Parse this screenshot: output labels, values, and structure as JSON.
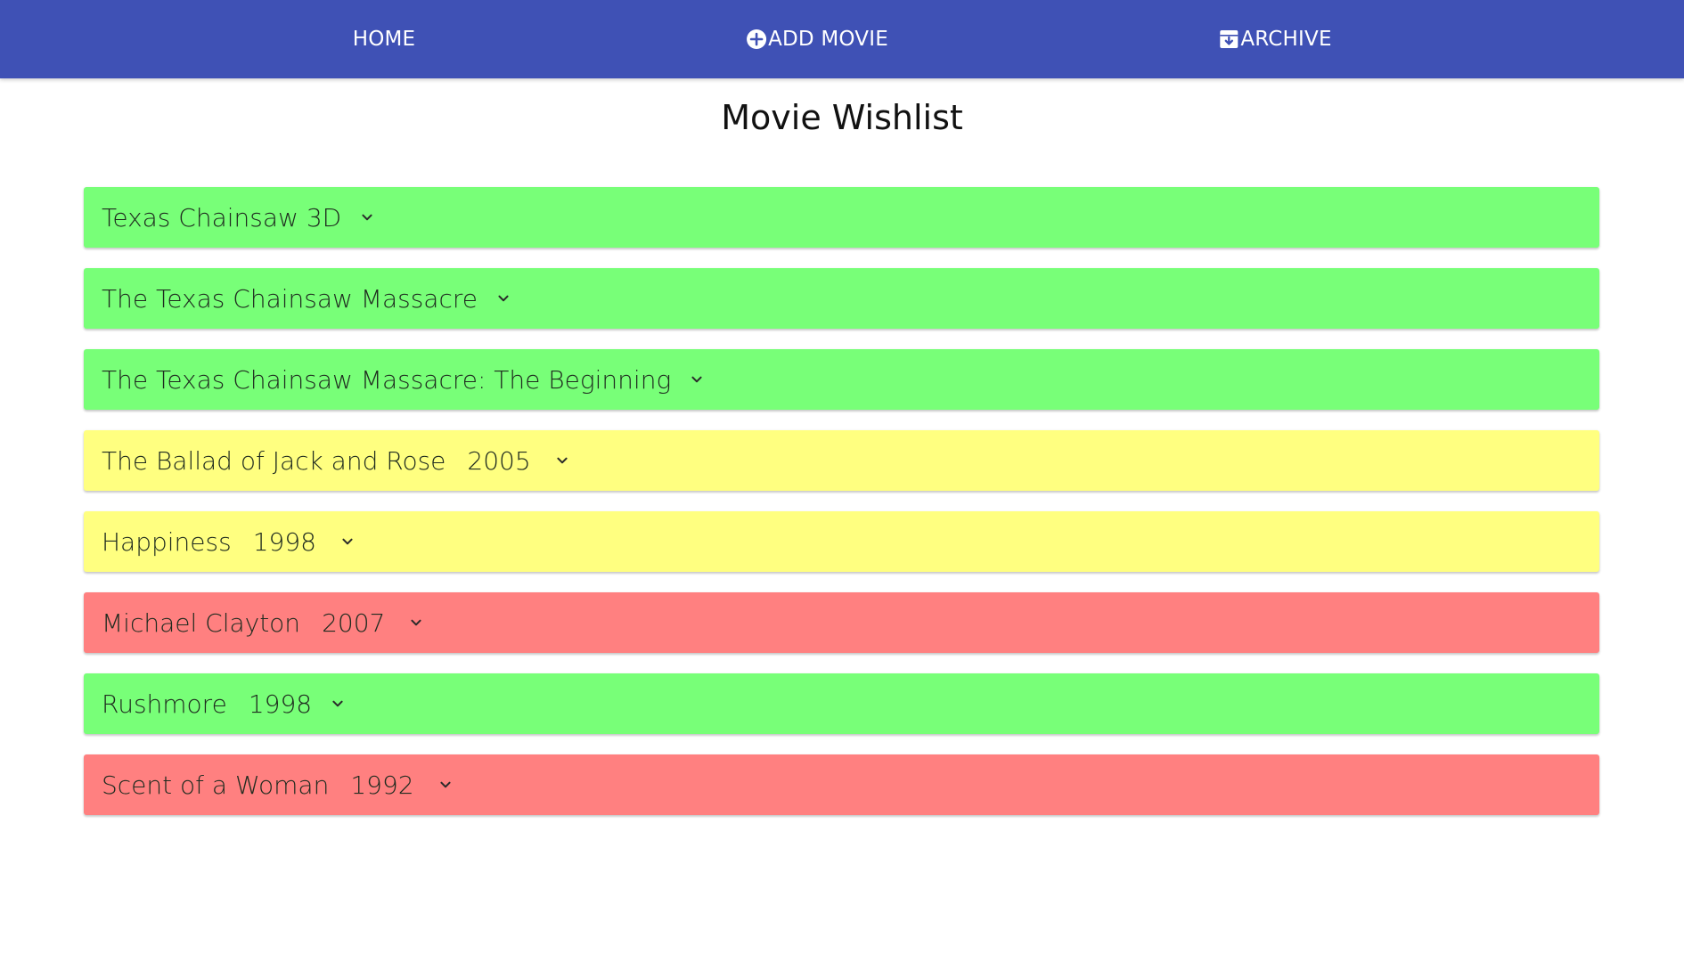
{
  "nav": {
    "home_label": "HOME",
    "add_label": "ADD MOVIE",
    "archive_label": "ARCHIVE",
    "add_icon": "add-circle-icon",
    "archive_icon": "archive-icon"
  },
  "page": {
    "title": "Movie Wishlist"
  },
  "colors": {
    "navbar": "#3f51b5",
    "green": "#78ff78",
    "yellow": "#ffff80",
    "red": "#ff8080"
  },
  "movies": [
    {
      "title": "Texas Chainsaw 3D",
      "year": "",
      "status": "green"
    },
    {
      "title": "The Texas Chainsaw Massacre",
      "year": "",
      "status": "green"
    },
    {
      "title": "The Texas Chainsaw Massacre: The Beginning",
      "year": "",
      "status": "green"
    },
    {
      "title": "The Ballad of Jack and Rose",
      "year": "2005",
      "status": "yellow"
    },
    {
      "title": "Happiness",
      "year": "1998",
      "status": "yellow"
    },
    {
      "title": "Michael Clayton",
      "year": "2007",
      "status": "red"
    },
    {
      "title": "Rushmore",
      "year": "1998",
      "status": "green"
    },
    {
      "title": "Scent of a Woman",
      "year": "1992",
      "status": "red"
    }
  ]
}
